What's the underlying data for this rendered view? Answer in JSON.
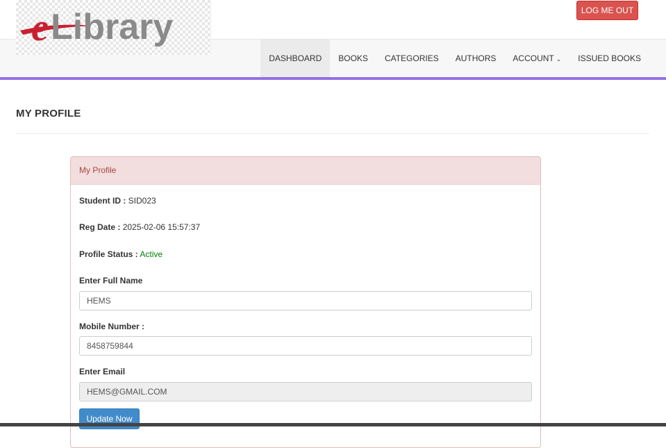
{
  "header": {
    "logo_text": "eLibrary",
    "logout_label": "LOG ME OUT"
  },
  "nav": {
    "items": [
      {
        "label": "DASHBOARD"
      },
      {
        "label": "BOOKS"
      },
      {
        "label": "CATEGORIES"
      },
      {
        "label": "AUTHORS"
      },
      {
        "label": "ACCOUNT"
      },
      {
        "label": "ISSUED BOOKS"
      }
    ],
    "active": "DASHBOARD",
    "account_icon": "chevron-down-icon"
  },
  "page": {
    "title": "MY PROFILE"
  },
  "panel": {
    "heading": "My Profile",
    "student_id_label": "Student ID :",
    "student_id": "SID023",
    "reg_date_label": "Reg Date :",
    "reg_date": "2025-02-06 15:57:37",
    "status_label": "Profile Status :",
    "status": "Active",
    "fullname_label": "Enter Full Name",
    "fullname_value": "HEMS",
    "mobile_label": "Mobile Number :",
    "mobile_value": "8458759844",
    "email_label": "Enter Email",
    "email_value": "HEMS@GMAIL.COM",
    "update_label": "Update Now"
  },
  "colors": {
    "accent": "#9170e6",
    "logout": "#d9534f",
    "panel_heading_bg": "#f2dede",
    "panel_heading_text": "#a94442",
    "status_active": "#008000",
    "primary_button": "#428bca"
  }
}
